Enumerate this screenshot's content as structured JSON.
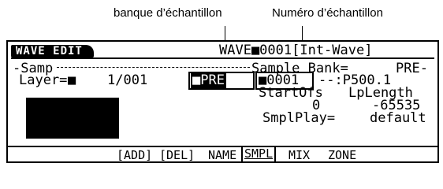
{
  "callouts": {
    "bank_label": "banque d’échantillon",
    "number_label": "Numéro d’échantillon"
  },
  "screen": {
    "mode_tag": "WAVE EDIT",
    "wave_id": "WAVE■0001[Int-Wave]",
    "section": "-Samp",
    "sample_bank_label": "Sample Bank=",
    "sample_bank_value": "PRE-",
    "layer_label": "Layer=",
    "layer_value": "■",
    "layer_index": "1/001",
    "bank_field": "■PRE",
    "number_field": "■0001",
    "sample_name": "--:P500.1",
    "start_ofs_label": "StartOfs",
    "lp_length_label": "LpLength",
    "start_ofs_value": "0",
    "lp_length_value": "-65535",
    "smpl_play_label": "SmplPlay=",
    "smpl_play_value": "default"
  },
  "tabs": [
    {
      "label": "[ADD]"
    },
    {
      "label": "[DEL]"
    },
    {
      "label": "NAME"
    },
    {
      "label": "SMPL",
      "selected": true
    },
    {
      "label": "MIX"
    },
    {
      "label": "ZONE"
    }
  ]
}
